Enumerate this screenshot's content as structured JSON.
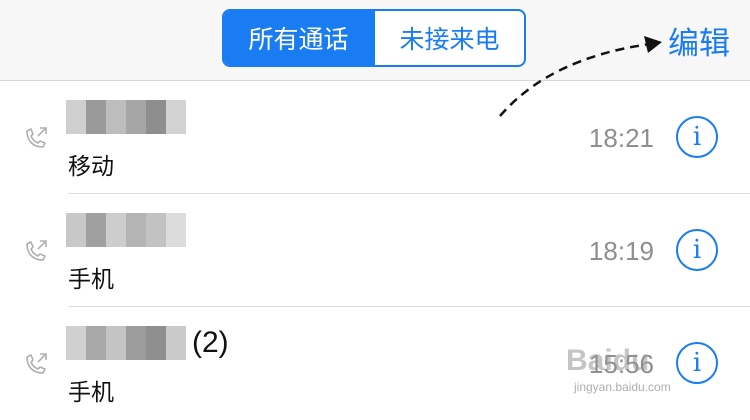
{
  "header": {
    "tabs": [
      {
        "label": "所有通话",
        "active": true
      },
      {
        "label": "未接来电",
        "active": false
      }
    ],
    "edit_label": "编辑"
  },
  "calls": [
    {
      "name_suffix": "",
      "type": "移动",
      "time": "18:21",
      "info_glyph": "i"
    },
    {
      "name_suffix": "",
      "type": "手机",
      "time": "18:19",
      "info_glyph": "i"
    },
    {
      "name_suffix": "(2)",
      "type": "手机",
      "time": "15:56",
      "info_glyph": "i"
    }
  ],
  "watermark": {
    "text": "Baidu",
    "sub": "jingyan.baidu.com"
  },
  "colors": {
    "accent": "#1a7cf3",
    "time_gray": "#8e8e93",
    "separator": "#dcdcdc"
  }
}
